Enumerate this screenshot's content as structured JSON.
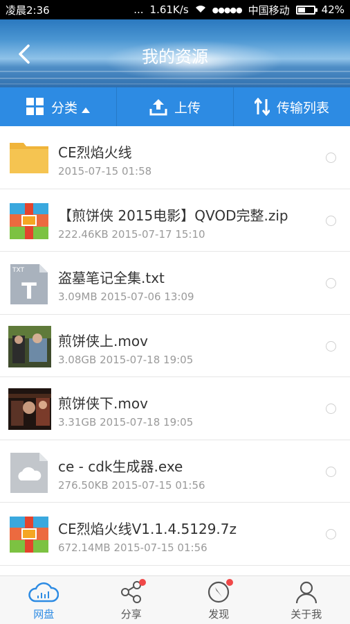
{
  "status_bar": {
    "time": "凌晨2:36",
    "dots": "...",
    "speed": "1.61K/s",
    "signal": "●●●●●",
    "carrier": "中国移动",
    "battery": "42%",
    "battery_level": 0.42
  },
  "header": {
    "title": "我的资源",
    "back_icon": "back-arrow-icon"
  },
  "toolbar": {
    "category_label": "分类",
    "upload_label": "上传",
    "transfer_label": "传输列表"
  },
  "files": [
    {
      "name": "CE烈焰火线",
      "meta": "2015-07-15  01:58",
      "icon": "folder-icon"
    },
    {
      "name": "【煎饼侠 2015电影】QVOD完整.zip",
      "meta": "222.46KB  2015-07-17  15:10",
      "icon": "zip-icon"
    },
    {
      "name": "盗墓笔记全集.txt",
      "meta": "3.09MB  2015-07-06  13:09",
      "icon": "txt-icon",
      "badge": "TXT",
      "letter": "T"
    },
    {
      "name": "煎饼侠上.mov",
      "meta": "3.08GB  2015-07-18  19:05",
      "icon": "video-thumbnail"
    },
    {
      "name": "煎饼侠下.mov",
      "meta": "3.31GB  2015-07-18  19:05",
      "icon": "video-thumbnail"
    },
    {
      "name": "ce  - cdk生成器.exe",
      "meta": "276.50KB  2015-07-15  01:56",
      "icon": "cloud-file-icon"
    },
    {
      "name": "CE烈焰火线V1.1.4.5129.7z",
      "meta": "672.14MB  2015-07-15  01:56",
      "icon": "zip-icon"
    }
  ],
  "tabs": [
    {
      "label": "网盘",
      "icon": "cloud-icon",
      "active": true
    },
    {
      "label": "分享",
      "icon": "share-icon",
      "badge": true
    },
    {
      "label": "发现",
      "icon": "compass-icon",
      "badge": true
    },
    {
      "label": "关于我",
      "icon": "person-icon"
    }
  ],
  "colors": {
    "accent": "#2d8be3",
    "badge": "#f04848"
  }
}
